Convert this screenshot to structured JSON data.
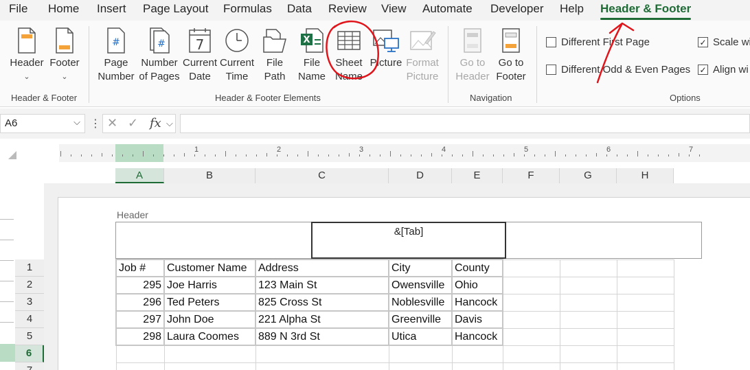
{
  "menu_tabs": [
    "File",
    "Home",
    "Insert",
    "Page Layout",
    "Formulas",
    "Data",
    "Review",
    "View",
    "Automate",
    "Developer",
    "Help",
    "Header & Footer"
  ],
  "active_tab": "Header & Footer",
  "ribbon": {
    "header_btn": "Header",
    "footer_btn": "Footer",
    "group_hf": "Header & Footer",
    "page_number": [
      "Page",
      "Number"
    ],
    "number_of_pages": [
      "Number",
      "of Pages"
    ],
    "current_date": [
      "Current",
      "Date"
    ],
    "current_time": [
      "Current",
      "Time"
    ],
    "file_path": [
      "File",
      "Path"
    ],
    "file_name": [
      "File",
      "Name"
    ],
    "sheet_name": [
      "Sheet",
      "Name"
    ],
    "picture": "Picture",
    "format_picture": [
      "Format",
      "Picture"
    ],
    "group_elements": "Header & Footer Elements",
    "goto_header": [
      "Go to",
      "Header"
    ],
    "goto_footer": [
      "Go to",
      "Footer"
    ],
    "group_nav": "Navigation",
    "opt_first": "Different First Page",
    "opt_oddeven": "Different Odd & Even Pages",
    "opt_scale": "Scale wi",
    "opt_align": "Align wi",
    "group_options": "Options"
  },
  "formula_bar": {
    "name_box": "A6",
    "fx": "fx",
    "value": ""
  },
  "ruler_numbers": [
    "1",
    "2",
    "3",
    "4",
    "5",
    "6",
    "7"
  ],
  "columns": [
    "A",
    "B",
    "C",
    "D",
    "E",
    "F",
    "G",
    "H"
  ],
  "rows": [
    "1",
    "2",
    "3",
    "4",
    "5",
    "6",
    "7"
  ],
  "header_label": "Header",
  "header_center": "&[Tab]",
  "table": {
    "headers": [
      "Job #",
      "Customer Name",
      "Address",
      "City",
      "County"
    ],
    "rows": [
      [
        "295",
        "Joe Harris",
        "123 Main St",
        "Owensville",
        "Ohio"
      ],
      [
        "296",
        "Ted Peters",
        "825 Cross St",
        "Noblesville",
        "Hancock"
      ],
      [
        "297",
        "John Doe",
        "221 Alpha St",
        "Greenville",
        "Davis"
      ],
      [
        "298",
        "Laura Coomes",
        "889 N 3rd St",
        "Utica",
        "Hancock"
      ]
    ]
  },
  "colors": {
    "accent": "#1e6b36",
    "annotation": "#e0151b",
    "selected_header": "#d6e5db"
  }
}
